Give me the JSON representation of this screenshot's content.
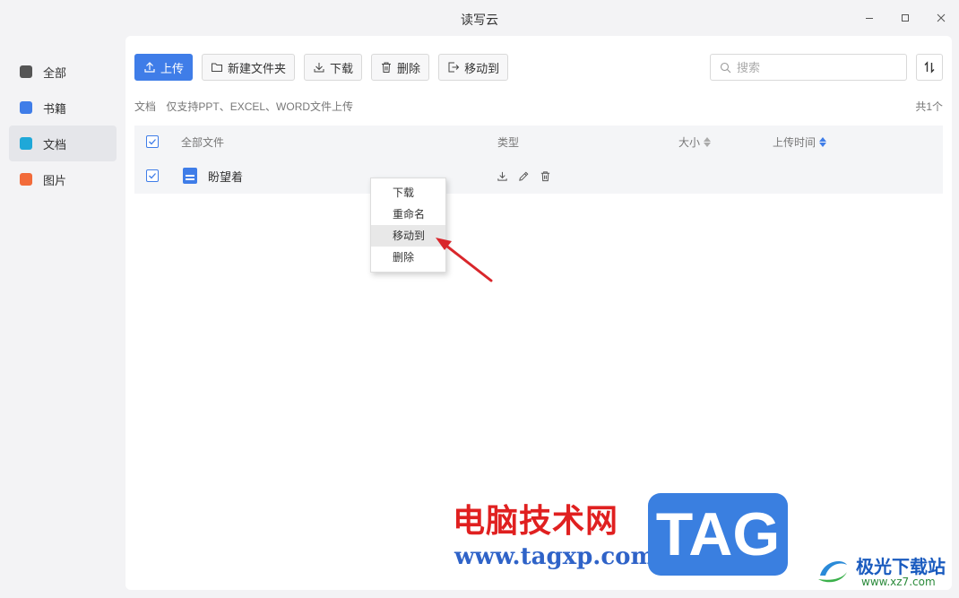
{
  "window": {
    "title": "读写云"
  },
  "sidebar": {
    "items": [
      {
        "label": "全部",
        "icon": "folder-icon",
        "color": "#555555"
      },
      {
        "label": "书籍",
        "icon": "book-icon",
        "color": "#3f7de8"
      },
      {
        "label": "文档",
        "icon": "document-icon",
        "color": "#1fa8d8",
        "active": true
      },
      {
        "label": "图片",
        "icon": "image-icon",
        "color": "#f26b3a"
      }
    ]
  },
  "toolbar": {
    "upload_label": "上传",
    "new_folder_label": "新建文件夹",
    "download_label": "下载",
    "delete_label": "删除",
    "move_label": "移动到"
  },
  "search": {
    "placeholder": "搜索"
  },
  "info": {
    "section": "文档",
    "hint": "仅支持PPT、EXCEL、WORD文件上传",
    "count": "共1个"
  },
  "table": {
    "headers": {
      "name": "全部文件",
      "type": "类型",
      "size": "大小",
      "time": "上传时间"
    },
    "rows": [
      {
        "name": "盼望着",
        "checked": true
      }
    ]
  },
  "context_menu": {
    "items": [
      "下载",
      "重命名",
      "移动到",
      "删除"
    ],
    "highlighted": "移动到"
  },
  "watermark": {
    "cn": "电脑技术网",
    "url": "www.tagxp.com",
    "tag": "TAG",
    "site2_cn": "极光下载站",
    "site2_url": "www.xz7.com"
  },
  "colors": {
    "accent": "#3f7de8",
    "arrow": "#d9262b"
  }
}
